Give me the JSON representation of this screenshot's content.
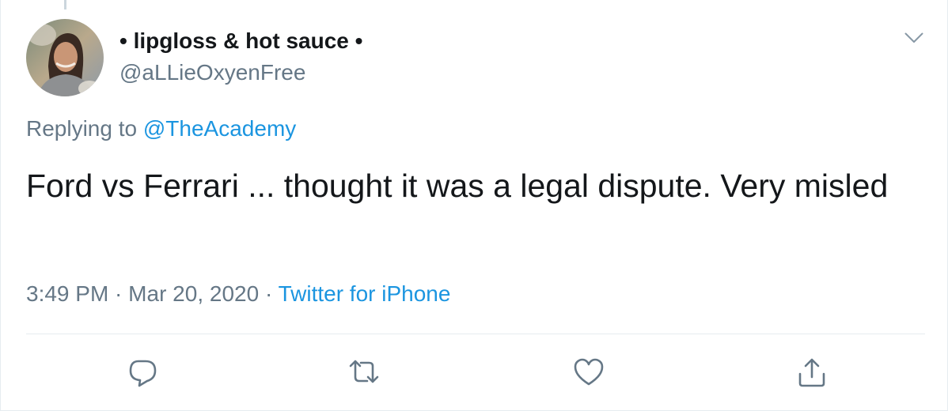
{
  "tweet": {
    "display_name": "• lipgloss & hot sauce •",
    "handle": "@aLLieOxyenFree",
    "replying_prefix": "Replying to ",
    "replying_to": "@TheAcademy",
    "text": "Ford vs Ferrari ... thought it was a legal dispute. Very misled",
    "time": "3:49 PM",
    "separator": " · ",
    "date": "Mar 20, 2020",
    "source": "Twitter for iPhone"
  },
  "icons": {
    "caret": "chevron-down-icon",
    "reply": "reply-icon",
    "retweet": "retweet-icon",
    "like": "heart-icon",
    "share": "share-icon"
  },
  "colors": {
    "text": "#14171a",
    "secondary": "#657786",
    "link": "#1b95e0",
    "divider": "#e6ecf0"
  }
}
